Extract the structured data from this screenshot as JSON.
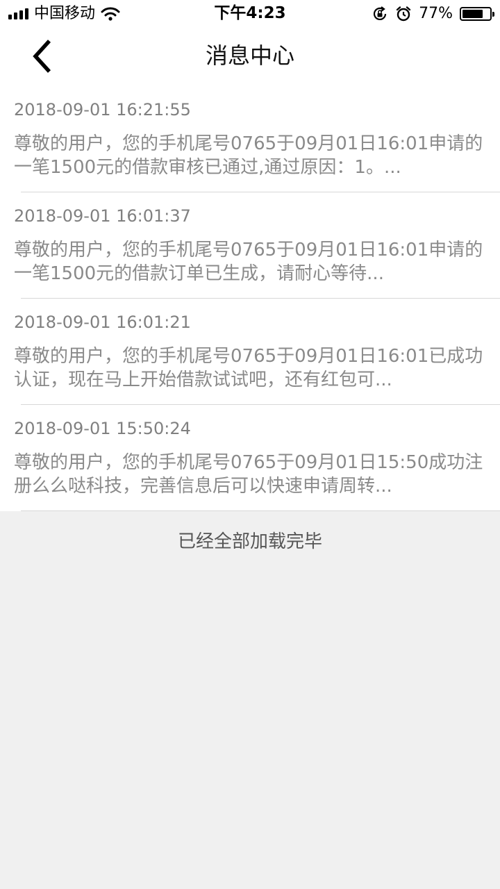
{
  "status_bar": {
    "carrier": "中国移动",
    "time": "下午4:23",
    "battery_percent": "77%",
    "battery_level": 0.77,
    "icons": [
      "signal-icon",
      "wifi-icon",
      "orientation-lock-icon",
      "alarm-icon",
      "battery-icon"
    ]
  },
  "nav": {
    "title": "消息中心",
    "back_icon": "chevron-left-icon"
  },
  "messages": [
    {
      "time": "2018-09-01 16:21:55",
      "body": "尊敬的用户，您的手机尾号0765于09月01日16:01申请的一笔1500元的借款审核已通过,通过原因：1。..."
    },
    {
      "time": "2018-09-01 16:01:37",
      "body": "尊敬的用户，您的手机尾号0765于09月01日16:01申请的一笔1500元的借款订单已生成，请耐心等待..."
    },
    {
      "time": "2018-09-01 16:01:21",
      "body": "尊敬的用户，您的手机尾号0765于09月01日16:01已成功认证，现在马上开始借款试试吧，还有红包可..."
    },
    {
      "time": "2018-09-01 15:50:24",
      "body": "尊敬的用户，您的手机尾号0765于09月01日15:50成功注册么么哒科技，完善信息后可以快速申请周转..."
    }
  ],
  "footer": {
    "load_complete": "已经全部加载完毕"
  },
  "colors": {
    "background": "#f0f0f0",
    "card": "#ffffff",
    "text_muted": "#8a8a8a",
    "divider": "#d8d8d8"
  }
}
